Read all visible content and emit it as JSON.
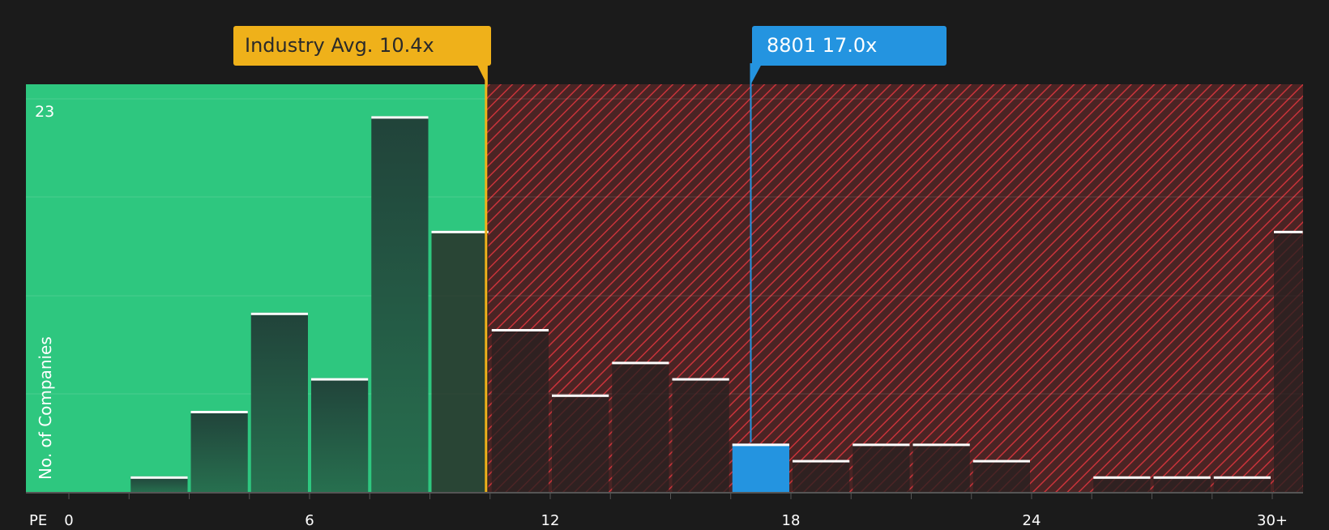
{
  "chart_data": {
    "type": "bar",
    "xlabel": "PE",
    "ylabel": "No. of Companies",
    "y_top_label": "23",
    "ylim": [
      0,
      23.8
    ],
    "xlim": [
      -1,
      30.8
    ],
    "x_ticks": [
      "0",
      "6",
      "12",
      "18",
      "24",
      "30+"
    ],
    "x_tick_values": [
      0,
      6,
      12,
      18,
      24,
      30
    ],
    "bin_width": 1.5,
    "bins": [
      {
        "x0": 1.5,
        "x1": 3.0,
        "value": 1
      },
      {
        "x0": 3.0,
        "x1": 4.5,
        "value": 5
      },
      {
        "x0": 4.5,
        "x1": 6.0,
        "value": 11
      },
      {
        "x0": 6.0,
        "x1": 7.5,
        "value": 7
      },
      {
        "x0": 7.5,
        "x1": 9.0,
        "value": 23
      },
      {
        "x0": 9.0,
        "x1": 10.5,
        "value": 16
      },
      {
        "x0": 10.5,
        "x1": 12.0,
        "value": 10
      },
      {
        "x0": 12.0,
        "x1": 13.5,
        "value": 6
      },
      {
        "x0": 13.5,
        "x1": 15.0,
        "value": 8
      },
      {
        "x0": 15.0,
        "x1": 16.5,
        "value": 7
      },
      {
        "x0": 16.5,
        "x1": 18.0,
        "value": 3,
        "highlight": true
      },
      {
        "x0": 18.0,
        "x1": 19.5,
        "value": 2
      },
      {
        "x0": 19.5,
        "x1": 21.0,
        "value": 3
      },
      {
        "x0": 21.0,
        "x1": 22.5,
        "value": 3
      },
      {
        "x0": 22.5,
        "x1": 24.0,
        "value": 2
      },
      {
        "x0": 25.5,
        "x1": 27.0,
        "value": 1
      },
      {
        "x0": 27.0,
        "x1": 28.5,
        "value": 1
      },
      {
        "x0": 28.5,
        "x1": 30.0,
        "value": 1
      },
      {
        "x0": 30.0,
        "x1": 30.8,
        "value": 16
      }
    ],
    "industry_avg": {
      "label": "Industry Avg. 10.4x",
      "value": 10.4
    },
    "company": {
      "label": "8801 17.0x",
      "value": 17.0
    },
    "colors": {
      "background": "#1b1b1b",
      "undervalued_zone": "#2ec77f",
      "overvalued_zone": "#4a2424",
      "hatch": "#c9333a",
      "bar_in_green": "#22473a",
      "bar_in_red": "#2e2424",
      "bar_cap": "#ffffff",
      "industry_line": "#efb11a",
      "company_bar": "#2494e0"
    }
  }
}
